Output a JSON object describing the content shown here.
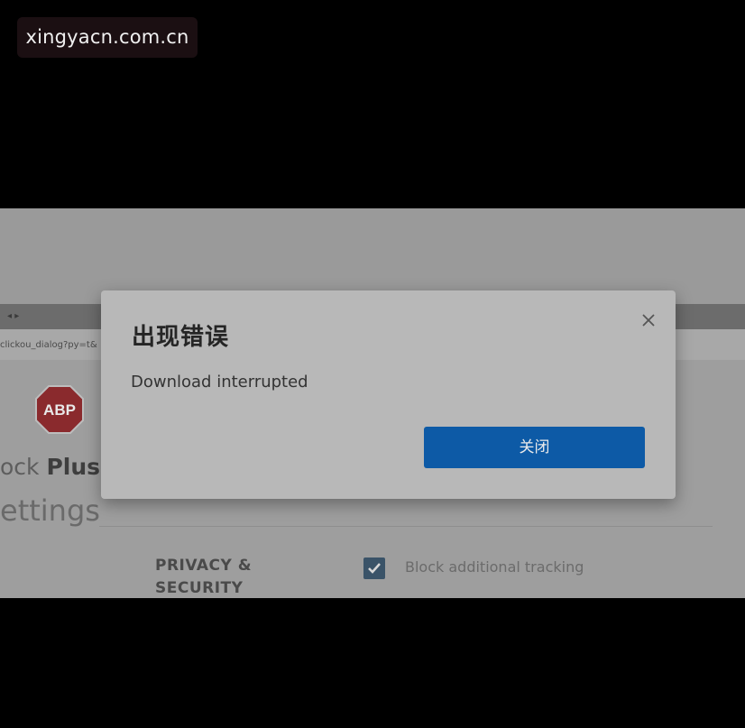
{
  "watermark": {
    "text": "xingyacn.com.cn"
  },
  "background_page": {
    "address_fragment": "clickou_dialog?py=t&",
    "logo_text": "ABP",
    "title_partial": "ock",
    "title_bold": "Plus",
    "settings_partial": "ettings",
    "section_label_line1": "PRIVACY &",
    "section_label_line2": "SECURITY",
    "checkbox_label": "Block additional tracking",
    "checkbox_checked": true
  },
  "dialog": {
    "title": "出现错误",
    "message": "Download interrupted",
    "close_button_label": "关闭",
    "close_icon": "close-icon"
  },
  "colors": {
    "accent": "#0d5aa6",
    "abp_red": "#b01e24",
    "overlay_bg": "#000000"
  }
}
